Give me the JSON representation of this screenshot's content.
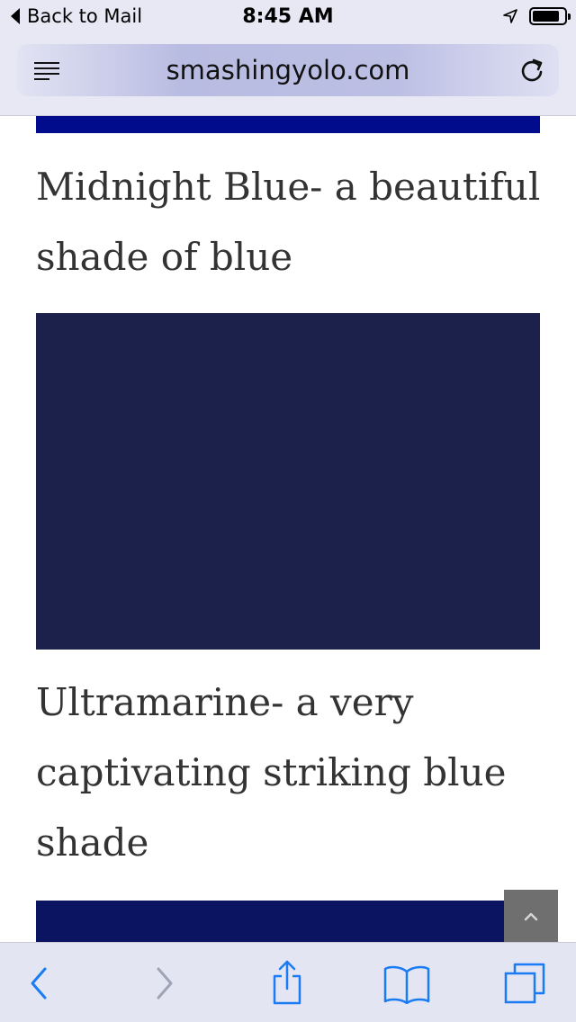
{
  "status_bar": {
    "back_label": "Back to Mail",
    "time": "8:45 AM"
  },
  "browser": {
    "url": "smashingyolo.com"
  },
  "content": {
    "captions": [
      "Midnight Blue- a beautiful shade of blue",
      "Ultramarine- a very captivating striking blue shade"
    ],
    "swatch_colors": {
      "top": "#000c8c",
      "midnight_blue": "#1b214b",
      "ultramarine": "#0a1460"
    }
  },
  "icons": {
    "status": [
      "back-arrow-icon",
      "location-arrow-icon",
      "battery-icon"
    ],
    "address_bar": [
      "reader-view-icon",
      "reload-icon"
    ],
    "toolbar": [
      "back-chevron-icon",
      "forward-chevron-icon",
      "share-icon",
      "bookmarks-icon",
      "tabs-icon"
    ],
    "content": [
      "scroll-to-top-icon"
    ]
  },
  "colors": {
    "accent": "#1a7cf5",
    "disabled": "#9fa3b3"
  }
}
